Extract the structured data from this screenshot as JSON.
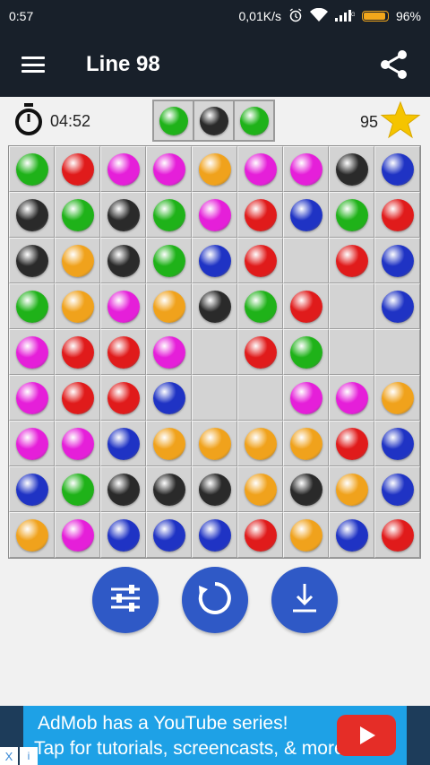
{
  "status_bar": {
    "time": "0:57",
    "network_speed": "0,01K/s",
    "battery": "96%",
    "icons": [
      "alarm-icon",
      "wifi-icon",
      "signal-icon",
      "battery-icon"
    ]
  },
  "app_bar": {
    "title": "Line 98",
    "menu_icon": "menu-icon",
    "share_icon": "share-icon"
  },
  "info": {
    "timer": "04:52",
    "score": "95",
    "next_balls": [
      "green",
      "black",
      "green"
    ]
  },
  "colors": {
    "green": "#1fb219",
    "red": "#e01b1b",
    "magenta": "#e51fd9",
    "orange": "#f0a21c",
    "black": "#2a2a2a",
    "blue": "#1f33c4",
    "button": "#2f59c6",
    "appbar": "#18202a",
    "star": "#f5c400"
  },
  "board": [
    [
      "green",
      "red",
      "magenta",
      "magenta",
      "orange",
      "magenta",
      "magenta",
      "black",
      "blue"
    ],
    [
      "black",
      "green",
      "black",
      "green",
      "magenta",
      "red",
      "blue",
      "green",
      "red"
    ],
    [
      "black",
      "orange",
      "black",
      "green",
      "blue",
      "red",
      "",
      "red",
      "blue"
    ],
    [
      "green",
      "orange",
      "magenta",
      "orange",
      "black",
      "green",
      "red",
      "",
      "blue"
    ],
    [
      "magenta",
      "red",
      "red",
      "magenta",
      "",
      "red",
      "green",
      "",
      ""
    ],
    [
      "magenta",
      "red",
      "red",
      "blue",
      "",
      "",
      "magenta",
      "magenta",
      "orange"
    ],
    [
      "magenta",
      "magenta",
      "blue",
      "orange",
      "orange",
      "orange",
      "orange",
      "red",
      "blue"
    ],
    [
      "blue",
      "green",
      "black",
      "black",
      "black",
      "orange",
      "black",
      "orange",
      "blue"
    ],
    [
      "orange",
      "magenta",
      "blue",
      "blue",
      "blue",
      "red",
      "orange",
      "blue",
      "red"
    ]
  ],
  "controls": [
    "settings-sliders-icon",
    "restart-icon",
    "download-icon"
  ],
  "ad": {
    "line1": "AdMob has a YouTube series!",
    "line2": "Tap for tutorials, screencasts, & more.",
    "close": "X",
    "info": "i"
  }
}
